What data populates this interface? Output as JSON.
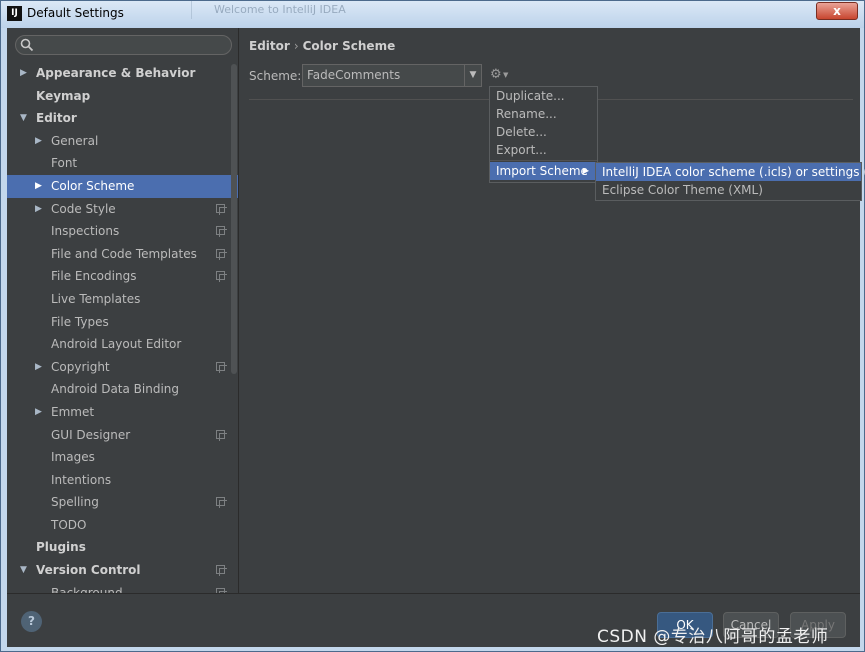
{
  "window": {
    "title": "Default Settings",
    "background_title": "Welcome to IntelliJ IDEA",
    "close_label": "x",
    "logo_text": "IJ"
  },
  "search": {
    "placeholder": ""
  },
  "tree": [
    {
      "label": "Appearance & Behavior",
      "bold": true,
      "arrow": "▶",
      "indent": 0,
      "selected": false,
      "project": false
    },
    {
      "label": "Keymap",
      "bold": true,
      "arrow": "",
      "indent": 0,
      "selected": false,
      "project": false
    },
    {
      "label": "Editor",
      "bold": true,
      "arrow": "▼",
      "indent": 0,
      "selected": false,
      "project": false
    },
    {
      "label": "General",
      "bold": false,
      "arrow": "▶",
      "indent": 1,
      "selected": false,
      "project": false
    },
    {
      "label": "Font",
      "bold": false,
      "arrow": "",
      "indent": 1,
      "selected": false,
      "project": false
    },
    {
      "label": "Color Scheme",
      "bold": false,
      "arrow": "▶",
      "indent": 1,
      "selected": true,
      "project": false
    },
    {
      "label": "Code Style",
      "bold": false,
      "arrow": "▶",
      "indent": 1,
      "selected": false,
      "project": true
    },
    {
      "label": "Inspections",
      "bold": false,
      "arrow": "",
      "indent": 1,
      "selected": false,
      "project": true
    },
    {
      "label": "File and Code Templates",
      "bold": false,
      "arrow": "",
      "indent": 1,
      "selected": false,
      "project": true
    },
    {
      "label": "File Encodings",
      "bold": false,
      "arrow": "",
      "indent": 1,
      "selected": false,
      "project": true
    },
    {
      "label": "Live Templates",
      "bold": false,
      "arrow": "",
      "indent": 1,
      "selected": false,
      "project": false
    },
    {
      "label": "File Types",
      "bold": false,
      "arrow": "",
      "indent": 1,
      "selected": false,
      "project": false
    },
    {
      "label": "Android Layout Editor",
      "bold": false,
      "arrow": "",
      "indent": 1,
      "selected": false,
      "project": false
    },
    {
      "label": "Copyright",
      "bold": false,
      "arrow": "▶",
      "indent": 1,
      "selected": false,
      "project": true
    },
    {
      "label": "Android Data Binding",
      "bold": false,
      "arrow": "",
      "indent": 1,
      "selected": false,
      "project": false
    },
    {
      "label": "Emmet",
      "bold": false,
      "arrow": "▶",
      "indent": 1,
      "selected": false,
      "project": false
    },
    {
      "label": "GUI Designer",
      "bold": false,
      "arrow": "",
      "indent": 1,
      "selected": false,
      "project": true
    },
    {
      "label": "Images",
      "bold": false,
      "arrow": "",
      "indent": 1,
      "selected": false,
      "project": false
    },
    {
      "label": "Intentions",
      "bold": false,
      "arrow": "",
      "indent": 1,
      "selected": false,
      "project": false
    },
    {
      "label": "Spelling",
      "bold": false,
      "arrow": "",
      "indent": 1,
      "selected": false,
      "project": true
    },
    {
      "label": "TODO",
      "bold": false,
      "arrow": "",
      "indent": 1,
      "selected": false,
      "project": false
    },
    {
      "label": "Plugins",
      "bold": true,
      "arrow": "",
      "indent": 0,
      "selected": false,
      "project": false
    },
    {
      "label": "Version Control",
      "bold": true,
      "arrow": "▼",
      "indent": 0,
      "selected": false,
      "project": true
    },
    {
      "label": "Background",
      "bold": false,
      "arrow": "",
      "indent": 1,
      "selected": false,
      "project": true
    }
  ],
  "breadcrumb": {
    "parent": "Editor",
    "separator": "›",
    "current": "Color Scheme"
  },
  "scheme": {
    "label": "Scheme:",
    "value": "FadeComments"
  },
  "gear_menu": {
    "duplicate": "Duplicate...",
    "rename": "Rename...",
    "delete": "Delete...",
    "export": "Export...",
    "import": "Import Scheme"
  },
  "sub_menu": {
    "intellij": "IntelliJ IDEA color scheme (.icls) or settings (.jar)",
    "eclipse": "Eclipse Color Theme (XML)"
  },
  "footer": {
    "help": "?",
    "ok": "OK",
    "cancel": "Cancel",
    "apply": "Apply"
  },
  "watermark": "CSDN @专治八阿哥的孟老师",
  "colors": {
    "selection": "#4b6eaf",
    "background": "#3c3f41"
  }
}
